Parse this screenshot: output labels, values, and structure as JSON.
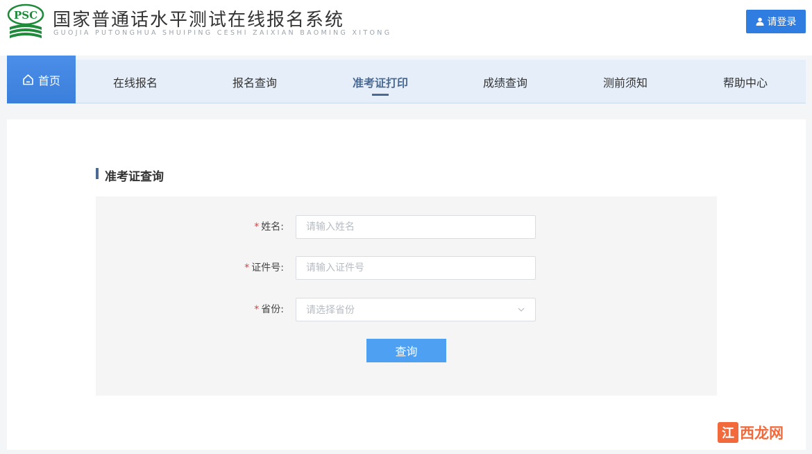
{
  "header": {
    "logo_text": "PSC",
    "title": "国家普通话水平测试在线报名系统",
    "subtitle": "GUOJIA PUTONGHUA SHUIPING CESHI ZAIXIAN BAOMING XITONG",
    "login_label": "请登录",
    "login_icon": "user-icon"
  },
  "nav": {
    "home_label": "首页",
    "home_icon": "home-icon",
    "items": [
      {
        "label": "在线报名"
      },
      {
        "label": "报名查询"
      },
      {
        "label": "准考证打印",
        "active": true
      },
      {
        "label": "成绩查询"
      },
      {
        "label": "测前须知"
      },
      {
        "label": "帮助中心"
      }
    ]
  },
  "section": {
    "title": "准考证查询"
  },
  "form": {
    "name_label": "姓名:",
    "name_placeholder": "请输入姓名",
    "id_label": "证件号:",
    "id_placeholder": "请输入证件号",
    "province_label": "省份:",
    "province_placeholder": "请选择省份",
    "required_mark": "*",
    "submit_label": "查询"
  },
  "watermark": {
    "badge": "江",
    "text": "西龙网"
  },
  "colors": {
    "primary": "#2f7de1",
    "button": "#4da0f2",
    "nav_bg": "#e6eff9",
    "active_nav": "#4a6a94",
    "required": "#e5393b"
  }
}
